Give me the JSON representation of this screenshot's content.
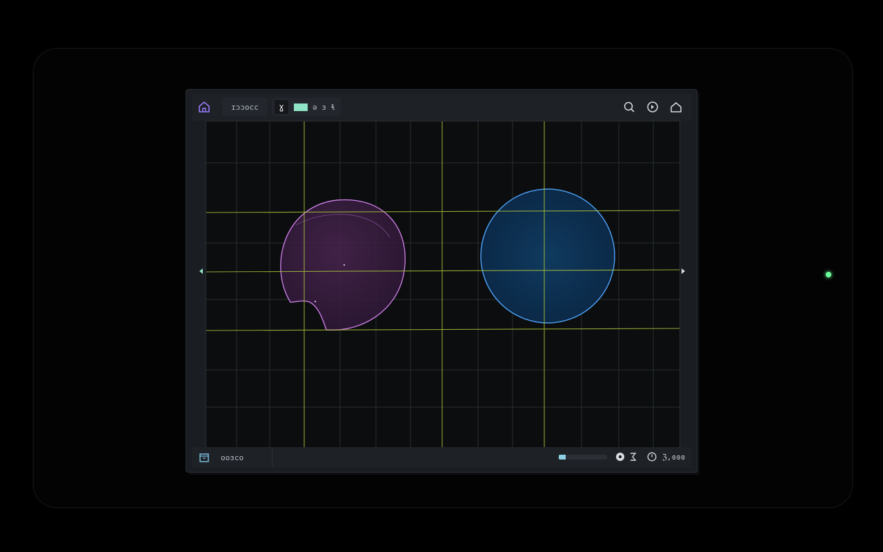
{
  "colors": {
    "grid_minor": "#2a2f2c",
    "grid_major": "#a9c23d",
    "accent_violet": "#9a7cff",
    "swatch": "#8fe3c6",
    "shape_magenta": "#c77be0",
    "shape_blue": "#4a9bee",
    "led": "#6dff9a"
  },
  "toolbar": {
    "home_icon": "home-icon",
    "label_1": "ɪɔɔocc",
    "tool_glyph": "ɣ",
    "label_2": "ə ɜ ɬ",
    "right_icons": [
      "search-icon",
      "target-icon",
      "home-icon"
    ]
  },
  "status_bar": {
    "left_icon": "archive-icon",
    "left_label": "ooɜco",
    "progress": 0.14,
    "icons": [
      "lock-icon",
      "sigma-icon",
      "clock-icon"
    ],
    "right_label": "ℨ,ɞɞɞ"
  }
}
